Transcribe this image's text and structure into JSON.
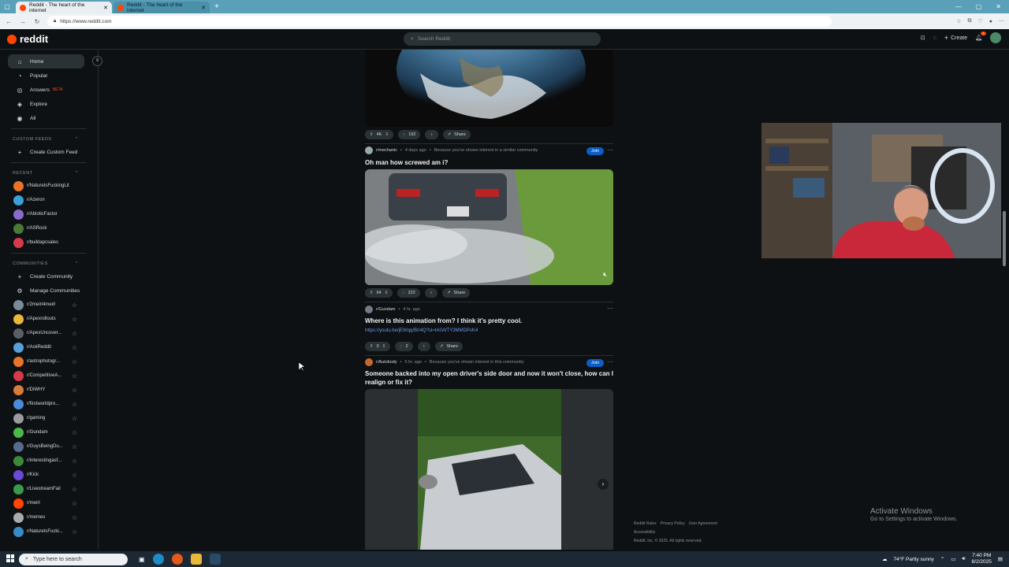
{
  "browser": {
    "tabs": [
      {
        "title": "Reddit - The heart of the internet",
        "active": true
      },
      {
        "title": "Reddit - The heart of the internet",
        "active": false
      }
    ],
    "url": "https://www.reddit.com"
  },
  "header": {
    "brand": "reddit",
    "search_placeholder": "Search Reddit",
    "create_label": "Create",
    "notification_count": "1"
  },
  "sidebar": {
    "nav": [
      {
        "label": "Home",
        "icon": "home-icon"
      },
      {
        "label": "Popular",
        "icon": "popular-icon"
      },
      {
        "label": "Answers",
        "icon": "answers-icon",
        "badge": "BETA"
      },
      {
        "label": "Explore",
        "icon": "explore-icon"
      },
      {
        "label": "All",
        "icon": "all-icon"
      }
    ],
    "custom_feeds": {
      "heading": "CUSTOM FEEDS",
      "create_label": "Create Custom Feed"
    },
    "recent": {
      "heading": "RECENT",
      "items": [
        "r/NatureIsFuckingLit",
        "r/Azeron",
        "r/AbioticFactor",
        "r/ASRock",
        "r/buildapcsales"
      ]
    },
    "communities": {
      "heading": "COMMUNITIES",
      "create_label": "Create Community",
      "manage_label": "Manage Communities",
      "items": [
        "r/2meirl4meirl",
        "r/Apexrollouts",
        "r/ApexUncover...",
        "r/AskReddit",
        "r/astrophotogr...",
        "r/CompetitiveA...",
        "r/DiWHY",
        "r/firstworldpro...",
        "r/gaming",
        "r/Gundam",
        "r/GuysBeingDu...",
        "r/interestingasf...",
        "r/Kick",
        "r/LivestreamFail",
        "r/meirl",
        "r/memes",
        "r/NatureIsFucki..."
      ]
    }
  },
  "feed": {
    "post0": {
      "upvotes": "4K",
      "comments": "192",
      "share": "Share"
    },
    "post1": {
      "sub": "r/mechanic",
      "time": "4 days ago",
      "reason": "Because you've shown interest in a similar community",
      "join": "Join",
      "title": "Oh man how screwed am i?",
      "upvotes": "64",
      "comments": "222",
      "share": "Share"
    },
    "post2": {
      "sub": "r/Gundam",
      "time": "4 hr. ago",
      "title": "Where is this animation from? I think it's pretty cool.",
      "link": "https://youtu.be/jEWqq/BrI4Q?si=tA0AfTY3MMDPvK4",
      "upvotes": "0",
      "comments": "2",
      "share": "Share"
    },
    "post3": {
      "sub": "r/Autobody",
      "time": "5 hr. ago",
      "reason": "Because you've shown interest in this community",
      "join": "Join",
      "title": "Someone backed into my open driver's side door and now it won't close, how can I realign or fix it?"
    }
  },
  "footer": {
    "links": [
      "Reddit Rules",
      "Privacy Policy",
      "User Agreement"
    ],
    "accessibility": "Accessibility",
    "copyright": "Reddit, Inc. © 2025. All rights reserved."
  },
  "watermark": {
    "line1": "Activate Windows",
    "line2": "Go to Settings to activate Windows."
  },
  "taskbar": {
    "search": "Type here to search",
    "weather": "74°F  Partly sunny",
    "time": "7:40 PM",
    "date": "8/2/2025"
  }
}
